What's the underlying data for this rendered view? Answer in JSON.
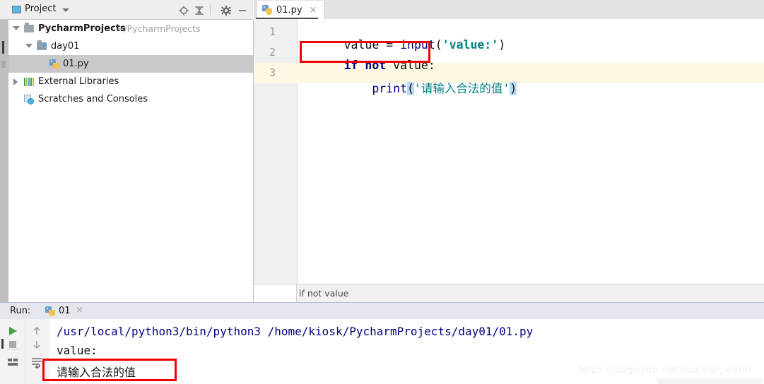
{
  "project_panel": {
    "title": "Project",
    "icons": [
      "locate-icon",
      "collapse-all-icon",
      "settings-gear-icon",
      "minimize-icon"
    ],
    "tree": [
      {
        "label": "PycharmProjects",
        "path_hint": "~/PycharmProjects",
        "icon": "folder-icon",
        "expanded": true,
        "depth": 0,
        "selected": false
      },
      {
        "label": "day01",
        "path_hint": "",
        "icon": "folder-module-icon",
        "expanded": true,
        "depth": 1,
        "selected": false
      },
      {
        "label": "01.py",
        "path_hint": "",
        "icon": "python-file-icon",
        "expanded": null,
        "depth": 2,
        "selected": true
      },
      {
        "label": "External Libraries",
        "path_hint": "",
        "icon": "libraries-icon",
        "expanded": false,
        "depth": 0,
        "selected": false
      },
      {
        "label": "Scratches and Consoles",
        "path_hint": "",
        "icon": "scratches-icon",
        "expanded": null,
        "depth": 0,
        "selected": false
      }
    ]
  },
  "editor": {
    "tab": {
      "label": "01.py",
      "icon": "python-file-icon",
      "close": "×"
    },
    "line_numbers": [
      "1",
      "2",
      "3"
    ],
    "lines": [
      {
        "number": "1",
        "tokens": [
          {
            "text": "value",
            "style": "plain"
          },
          {
            "text": " = ",
            "style": "plain"
          },
          {
            "text": "input",
            "style": "fn"
          },
          {
            "text": "(",
            "style": "plain"
          },
          {
            "text": "'value:'",
            "style": "str"
          },
          {
            "text": ")",
            "style": "plain"
          }
        ]
      },
      {
        "number": "2",
        "tokens": [
          {
            "text": "if",
            "style": "kw"
          },
          {
            "text": " ",
            "style": "plain"
          },
          {
            "text": "not",
            "style": "kw"
          },
          {
            "text": " value:",
            "style": "plain"
          }
        ]
      },
      {
        "number": "3",
        "tokens": [
          {
            "text": "    ",
            "style": "plain"
          },
          {
            "text": "print",
            "style": "fn"
          },
          {
            "text": "(",
            "style": "brace"
          },
          {
            "text": "'请输入合法的值'",
            "style": "str-cn"
          },
          {
            "text": ")",
            "style": "brace"
          }
        ]
      }
    ],
    "current_line": "3",
    "breadcrumb": "if not value",
    "annotation_box_line": "2"
  },
  "run_panel": {
    "label": "Run:",
    "tab_name": "01",
    "tab_icon": "python-file-icon",
    "tab_close": "×",
    "toolbar_icons": [
      "run-play-icon",
      "stop-icon",
      "print-layout-icon",
      "scroll-up-icon",
      "scroll-down-icon",
      "soft-wrap-icon"
    ],
    "console": [
      {
        "text": "/usr/local/python3/bin/python3 /home/kiosk/PycharmProjects/day01/01.py",
        "style": "cmd"
      },
      {
        "text": "value:",
        "style": "out"
      },
      {
        "text": "请输入合法的值",
        "style": "out-cn",
        "boxed": true
      }
    ]
  },
  "watermark": {
    "text": "https://blog.csdn.net/monster_warm"
  },
  "colors": {
    "accent_red": "#ee0000",
    "keyword_blue": "#000080",
    "string_teal": "#008080",
    "current_line_bg": "#fdf8e3",
    "selection_blue": "#b8d9f7",
    "run_green": "#45a33f"
  }
}
